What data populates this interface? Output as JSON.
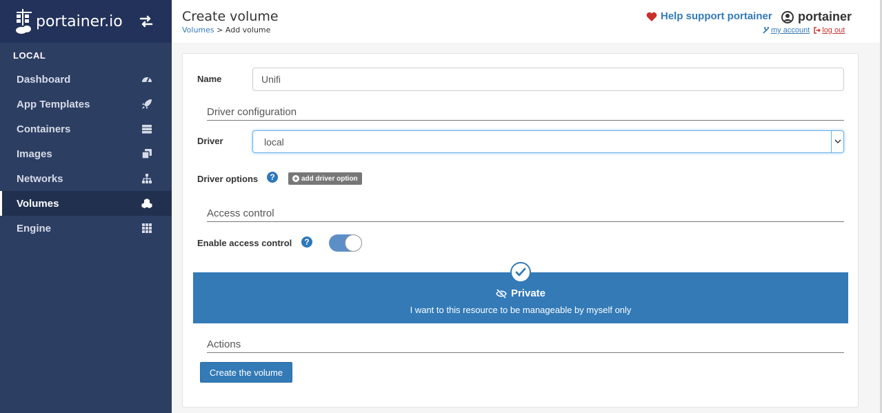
{
  "brand": {
    "name": "portainer.io"
  },
  "sidebar": {
    "environment": "LOCAL",
    "items": [
      {
        "label": "Dashboard",
        "icon": "tachometer-icon"
      },
      {
        "label": "App Templates",
        "icon": "rocket-icon"
      },
      {
        "label": "Containers",
        "icon": "server-icon"
      },
      {
        "label": "Images",
        "icon": "clone-icon"
      },
      {
        "label": "Networks",
        "icon": "sitemap-icon"
      },
      {
        "label": "Volumes",
        "icon": "cubes-icon",
        "active": true
      },
      {
        "label": "Engine",
        "icon": "th-icon"
      }
    ]
  },
  "header": {
    "title": "Create volume",
    "breadcrumb": {
      "parent": "Volumes",
      "separator": " > ",
      "current": "Add volume"
    },
    "help_support": "Help support portainer",
    "username": "portainer",
    "my_account": "my account",
    "log_out": "log out"
  },
  "form": {
    "name_label": "Name",
    "name_value": "Unifi",
    "driver_section": "Driver configuration",
    "driver_label": "Driver",
    "driver_value": "local",
    "driver_options_label": "Driver options",
    "add_driver_option": "add driver option",
    "access_section": "Access control",
    "enable_access_label": "Enable access control",
    "enable_access_on": true,
    "private_title": "Private",
    "private_desc": "I want to this resource to be manageable by myself only",
    "actions_section": "Actions",
    "create_button": "Create the volume"
  },
  "colors": {
    "sidebar_bg": "#2d3e63",
    "primary": "#337ab7",
    "heart": "#c9302c"
  }
}
